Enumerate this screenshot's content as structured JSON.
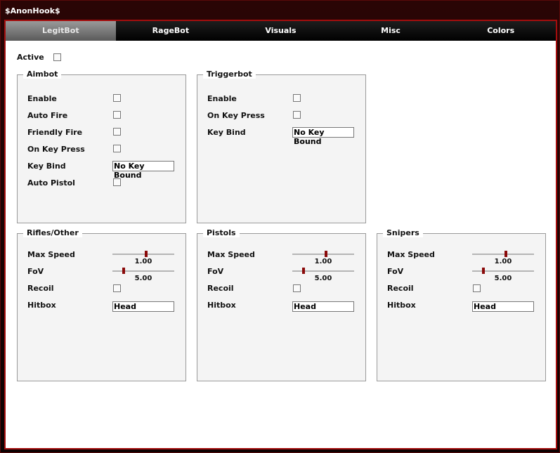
{
  "window": {
    "title": "$AnonHook$"
  },
  "tabs": [
    {
      "label": "LegitBot",
      "active": true
    },
    {
      "label": "RageBot",
      "active": false
    },
    {
      "label": "Visuals",
      "active": false
    },
    {
      "label": "Misc",
      "active": false
    },
    {
      "label": "Colors",
      "active": false
    }
  ],
  "active_label": "Active",
  "aimbot": {
    "title": "Aimbot",
    "enable": "Enable",
    "auto_fire": "Auto Fire",
    "friendly_fire": "Friendly Fire",
    "on_key_press": "On Key Press",
    "key_bind": "Key Bind",
    "key_bind_value": "No Key Bound",
    "auto_pistol": "Auto Pistol"
  },
  "triggerbot": {
    "title": "Triggerbot",
    "enable": "Enable",
    "on_key_press": "On Key Press",
    "key_bind": "Key Bind",
    "key_bind_value": "No Key Bound"
  },
  "rifles": {
    "title": "Rifles/Other",
    "max_speed": "Max Speed",
    "max_speed_value": "1.00",
    "fov": "FoV",
    "fov_value": "5.00",
    "recoil": "Recoil",
    "hitbox": "Hitbox",
    "hitbox_value": "Head"
  },
  "pistols": {
    "title": "Pistols",
    "max_speed": "Max Speed",
    "max_speed_value": "1.00",
    "fov": "FoV",
    "fov_value": "5.00",
    "recoil": "Recoil",
    "hitbox": "Hitbox",
    "hitbox_value": "Head"
  },
  "snipers": {
    "title": "Snipers",
    "max_speed": "Max Speed",
    "max_speed_value": "1.00",
    "fov": "FoV",
    "fov_value": "5.00",
    "recoil": "Recoil",
    "hitbox": "Hitbox",
    "hitbox_value": "Head"
  },
  "colors": {
    "accent": "#a30d0d",
    "slider_thumb": "#8a0a0a"
  }
}
